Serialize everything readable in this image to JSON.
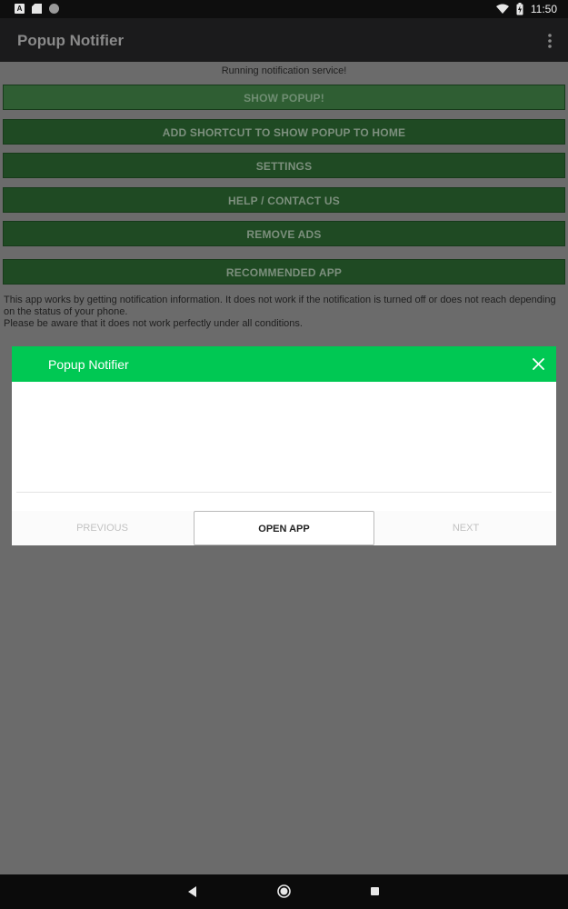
{
  "status_bar": {
    "time": "11:50",
    "icons": [
      "notification-a-icon",
      "sd-card-icon",
      "sync-circle-icon",
      "wifi-icon",
      "battery-charging-icon"
    ]
  },
  "app_bar": {
    "title": "Popup Notifier",
    "menu_icon": "overflow-menu-icon"
  },
  "main": {
    "service_status": "Running notification service!",
    "buttons": [
      {
        "label": "SHOW POPUP!"
      },
      {
        "label": "ADD SHORTCUT TO SHOW POPUP TO HOME"
      },
      {
        "label": "SETTINGS"
      },
      {
        "label": "HELP / CONTACT US"
      },
      {
        "label": "REMOVE ADS"
      },
      {
        "label": "RECOMMENDED APP"
      }
    ],
    "info_line1": "This app works by getting notification information. It does not work if the notification is turned off or does not reach depending on the status of your phone.",
    "info_line2": "Please be aware that it does not work perfectly under all conditions."
  },
  "dialog": {
    "title": "Popup Notifier",
    "close_icon": "close-icon",
    "actions": {
      "previous": "PREVIOUS",
      "open_app": "OPEN APP",
      "next": "NEXT"
    }
  },
  "nav_bar": {
    "icons": [
      "back-icon",
      "home-icon",
      "recents-icon"
    ]
  },
  "colors": {
    "accent": "#00c853",
    "button_bg": "#1f4a23",
    "scrim": "#6b6b6b"
  }
}
